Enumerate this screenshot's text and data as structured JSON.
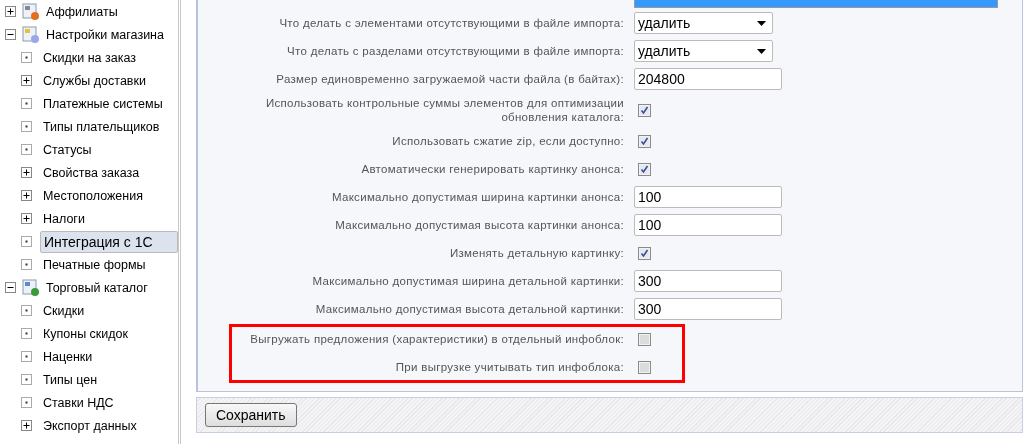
{
  "sidebar": {
    "items": [
      {
        "label": "Аффилиаты",
        "kind": "node",
        "expanded": false,
        "selected": false
      },
      {
        "label": "Настройки магазина",
        "kind": "node",
        "expanded": true,
        "selected": false,
        "children": [
          {
            "label": "Скидки на заказ",
            "kind": "leaf",
            "selected": false
          },
          {
            "label": "Службы доставки",
            "kind": "node",
            "expanded": false,
            "selected": false
          },
          {
            "label": "Платежные системы",
            "kind": "leaf",
            "selected": false
          },
          {
            "label": "Типы плательщиков",
            "kind": "leaf",
            "selected": false
          },
          {
            "label": "Статусы",
            "kind": "leaf",
            "selected": false
          },
          {
            "label": "Свойства заказа",
            "kind": "node",
            "expanded": false,
            "selected": false
          },
          {
            "label": "Местоположения",
            "kind": "node",
            "expanded": false,
            "selected": false
          },
          {
            "label": "Налоги",
            "kind": "node",
            "expanded": false,
            "selected": false
          },
          {
            "label": "Интеграция с 1С",
            "kind": "leaf",
            "selected": true
          },
          {
            "label": "Печатные формы",
            "kind": "leaf",
            "selected": false
          }
        ]
      },
      {
        "label": "Торговый каталог",
        "kind": "node",
        "expanded": true,
        "selected": false,
        "children": [
          {
            "label": "Скидки",
            "kind": "leaf",
            "selected": false
          },
          {
            "label": "Купоны скидок",
            "kind": "leaf",
            "selected": false
          },
          {
            "label": "Наценки",
            "kind": "leaf",
            "selected": false
          },
          {
            "label": "Типы цен",
            "kind": "leaf",
            "selected": false
          },
          {
            "label": "Ставки НДС",
            "kind": "leaf",
            "selected": false
          },
          {
            "label": "Экспорт данных",
            "kind": "node",
            "expanded": false,
            "selected": false
          }
        ]
      }
    ]
  },
  "fields": [
    {
      "label": "Что делать с элементами отсутствующими в файле импорта:",
      "kind": "select",
      "value": "удалить"
    },
    {
      "label": "Что делать с разделами отсутствующими в файле импорта:",
      "kind": "select",
      "value": "удалить"
    },
    {
      "label": "Размер единовременно загружаемой части файла (в байтах):",
      "kind": "text",
      "value": "204800"
    },
    {
      "label": "Использовать контрольные суммы элементов для оптимизации обновления каталога:",
      "kind": "checkbox",
      "checked": true
    },
    {
      "label": "Использовать сжатие zip, если доступно:",
      "kind": "checkbox",
      "checked": true
    },
    {
      "label": "Автоматически генерировать картинку анонса:",
      "kind": "checkbox",
      "checked": true
    },
    {
      "label": "Максимально допустимая ширина картинки анонса:",
      "kind": "text",
      "value": "100"
    },
    {
      "label": "Максимально допустимая высота картинки анонса:",
      "kind": "text",
      "value": "100"
    },
    {
      "label": "Изменять детальную картинку:",
      "kind": "checkbox",
      "checked": true
    },
    {
      "label": "Максимально допустимая ширина детальной картинки:",
      "kind": "text",
      "value": "300"
    },
    {
      "label": "Максимально допустимая высота детальной картинки:",
      "kind": "text",
      "value": "300"
    }
  ],
  "highlighted_fields": [
    {
      "label": "Выгружать предложения (характеристики) в отдельный инфоблок:",
      "kind": "checkbox",
      "checked": false
    },
    {
      "label": "При выгрузке учитывать тип инфоблока:",
      "kind": "checkbox",
      "checked": false
    }
  ],
  "save_button": "Сохранить"
}
